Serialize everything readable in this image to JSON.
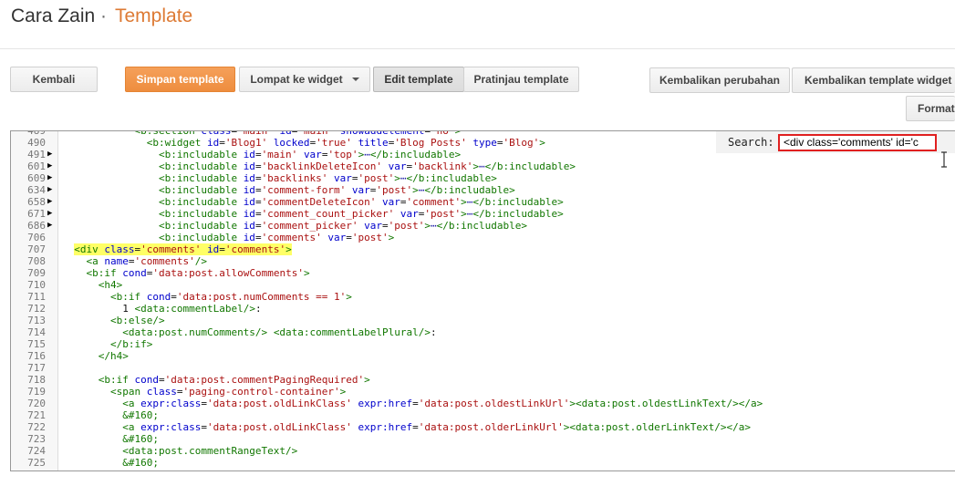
{
  "header": {
    "blog_name": "Cara Zain",
    "separator": "·",
    "page_title": "Template"
  },
  "toolbar": {
    "back_label": "Kembali",
    "save_label": "Simpan template",
    "jump_label": "Lompat ke widget",
    "edit_label": "Edit template",
    "preview_label": "Pratinjau template",
    "revert_label": "Kembalikan perubahan",
    "revert_widget_label": "Kembalikan template widget k",
    "format_label": "Format"
  },
  "search": {
    "label": "Search:",
    "value": "<div class='comments' id='c"
  },
  "editor": {
    "lines": [
      {
        "n": "489",
        "fold": false,
        "html": "            <span class='tag'>&lt;b:section</span> <span class='attr'>class</span>=<span class='str'>'main'</span> <span class='attr'>id</span>=<span class='str'>'main'</span> <span class='attr'>showaddelement</span>=<span class='str'>'no'</span><span class='tag'>&gt;</span>"
      },
      {
        "n": "490",
        "fold": false,
        "html": "              <span class='tag'>&lt;b:widget</span> <span class='attr'>id</span>=<span class='str'>'Blog1'</span> <span class='attr'>locked</span>=<span class='str'>'true'</span> <span class='attr'>title</span>=<span class='str'>'Blog Posts'</span> <span class='attr'>type</span>=<span class='str'>'Blog'</span><span class='tag'>&gt;</span>"
      },
      {
        "n": "491",
        "fold": true,
        "html": "                <span class='tag'>&lt;b:includable</span> <span class='attr'>id</span>=<span class='str'>'main'</span> <span class='attr'>var</span>=<span class='str'>'top'</span><span class='tag'>&gt;</span><span class='dots'>⋯</span><span class='tag'>&lt;/b:includable&gt;</span>"
      },
      {
        "n": "601",
        "fold": true,
        "html": "                <span class='tag'>&lt;b:includable</span> <span class='attr'>id</span>=<span class='str'>'backlinkDeleteIcon'</span> <span class='attr'>var</span>=<span class='str'>'backlink'</span><span class='tag'>&gt;</span><span class='dots'>⋯</span><span class='tag'>&lt;/b:includable&gt;</span>"
      },
      {
        "n": "609",
        "fold": true,
        "html": "                <span class='tag'>&lt;b:includable</span> <span class='attr'>id</span>=<span class='str'>'backlinks'</span> <span class='attr'>var</span>=<span class='str'>'post'</span><span class='tag'>&gt;</span><span class='dots'>⋯</span><span class='tag'>&lt;/b:includable&gt;</span>"
      },
      {
        "n": "634",
        "fold": true,
        "html": "                <span class='tag'>&lt;b:includable</span> <span class='attr'>id</span>=<span class='str'>'comment-form'</span> <span class='attr'>var</span>=<span class='str'>'post'</span><span class='tag'>&gt;</span><span class='dots'>⋯</span><span class='tag'>&lt;/b:includable&gt;</span>"
      },
      {
        "n": "658",
        "fold": true,
        "html": "                <span class='tag'>&lt;b:includable</span> <span class='attr'>id</span>=<span class='str'>'commentDeleteIcon'</span> <span class='attr'>var</span>=<span class='str'>'comment'</span><span class='tag'>&gt;</span><span class='dots'>⋯</span><span class='tag'>&lt;/b:includable&gt;</span>"
      },
      {
        "n": "671",
        "fold": true,
        "html": "                <span class='tag'>&lt;b:includable</span> <span class='attr'>id</span>=<span class='str'>'comment_count_picker'</span> <span class='attr'>var</span>=<span class='str'>'post'</span><span class='tag'>&gt;</span><span class='dots'>⋯</span><span class='tag'>&lt;/b:includable&gt;</span>"
      },
      {
        "n": "686",
        "fold": true,
        "html": "                <span class='tag'>&lt;b:includable</span> <span class='attr'>id</span>=<span class='str'>'comment_picker'</span> <span class='attr'>var</span>=<span class='str'>'post'</span><span class='tag'>&gt;</span><span class='dots'>⋯</span><span class='tag'>&lt;/b:includable&gt;</span>"
      },
      {
        "n": "706",
        "fold": false,
        "html": "                <span class='tag'>&lt;b:includable</span> <span class='attr'>id</span>=<span class='str'>'comments'</span> <span class='attr'>var</span>=<span class='str'>'post'</span><span class='tag'>&gt;</span>"
      },
      {
        "n": "707",
        "fold": false,
        "html": "  <span class='hl'><span class='tag'>&lt;div</span> <span class='attr'>class</span>=<span class='str'>'comments'</span> <span class='attr'>id</span>=<span class='str'>'comments'</span><span class='tag'>&gt;</span></span>"
      },
      {
        "n": "708",
        "fold": false,
        "html": "    <span class='tag'>&lt;a</span> <span class='attr'>name</span>=<span class='str'>'comments'</span><span class='tag'>/&gt;</span>"
      },
      {
        "n": "709",
        "fold": false,
        "html": "    <span class='tag'>&lt;b:if</span> <span class='attr'>cond</span>=<span class='str'>'data:post.allowComments'</span><span class='tag'>&gt;</span>"
      },
      {
        "n": "710",
        "fold": false,
        "html": "      <span class='tag'>&lt;h4&gt;</span>"
      },
      {
        "n": "711",
        "fold": false,
        "html": "        <span class='tag'>&lt;b:if</span> <span class='attr'>cond</span>=<span class='str'>'data:post.numComments == 1'</span><span class='tag'>&gt;</span>"
      },
      {
        "n": "712",
        "fold": false,
        "html": "          1 <span class='tag'>&lt;data:commentLabel/&gt;</span>:"
      },
      {
        "n": "713",
        "fold": false,
        "html": "        <span class='tag'>&lt;b:else/&gt;</span>"
      },
      {
        "n": "714",
        "fold": false,
        "html": "          <span class='tag'>&lt;data:post.numComments/&gt;</span> <span class='tag'>&lt;data:commentLabelPlural/&gt;</span>:"
      },
      {
        "n": "715",
        "fold": false,
        "html": "        <span class='tag'>&lt;/b:if&gt;</span>"
      },
      {
        "n": "716",
        "fold": false,
        "html": "      <span class='tag'>&lt;/h4&gt;</span>"
      },
      {
        "n": "717",
        "fold": false,
        "html": ""
      },
      {
        "n": "718",
        "fold": false,
        "html": "      <span class='tag'>&lt;b:if</span> <span class='attr'>cond</span>=<span class='str'>'data:post.commentPagingRequired'</span><span class='tag'>&gt;</span>"
      },
      {
        "n": "719",
        "fold": false,
        "html": "        <span class='tag'>&lt;span</span> <span class='attr'>class</span>=<span class='str'>'paging-control-container'</span><span class='tag'>&gt;</span>"
      },
      {
        "n": "720",
        "fold": false,
        "html": "          <span class='tag'>&lt;a</span> <span class='attr'>expr:class</span>=<span class='str'>'data:post.oldLinkClass'</span> <span class='attr'>expr:href</span>=<span class='str'>'data:post.oldestLinkUrl'</span><span class='tag'>&gt;&lt;data:post.oldestLinkText/&gt;&lt;/a&gt;</span>"
      },
      {
        "n": "721",
        "fold": false,
        "html": "          <span class='tag'>&amp;#160;</span>"
      },
      {
        "n": "722",
        "fold": false,
        "html": "          <span class='tag'>&lt;a</span> <span class='attr'>expr:class</span>=<span class='str'>'data:post.oldLinkClass'</span> <span class='attr'>expr:href</span>=<span class='str'>'data:post.olderLinkUrl'</span><span class='tag'>&gt;&lt;data:post.olderLinkText/&gt;&lt;/a&gt;</span>"
      },
      {
        "n": "723",
        "fold": false,
        "html": "          <span class='tag'>&amp;#160;</span>"
      },
      {
        "n": "724",
        "fold": false,
        "html": "          <span class='tag'>&lt;data:post.commentRangeText/&gt;</span>"
      },
      {
        "n": "725",
        "fold": false,
        "html": "          <span class='tag'>&amp;#160;</span>"
      }
    ]
  }
}
